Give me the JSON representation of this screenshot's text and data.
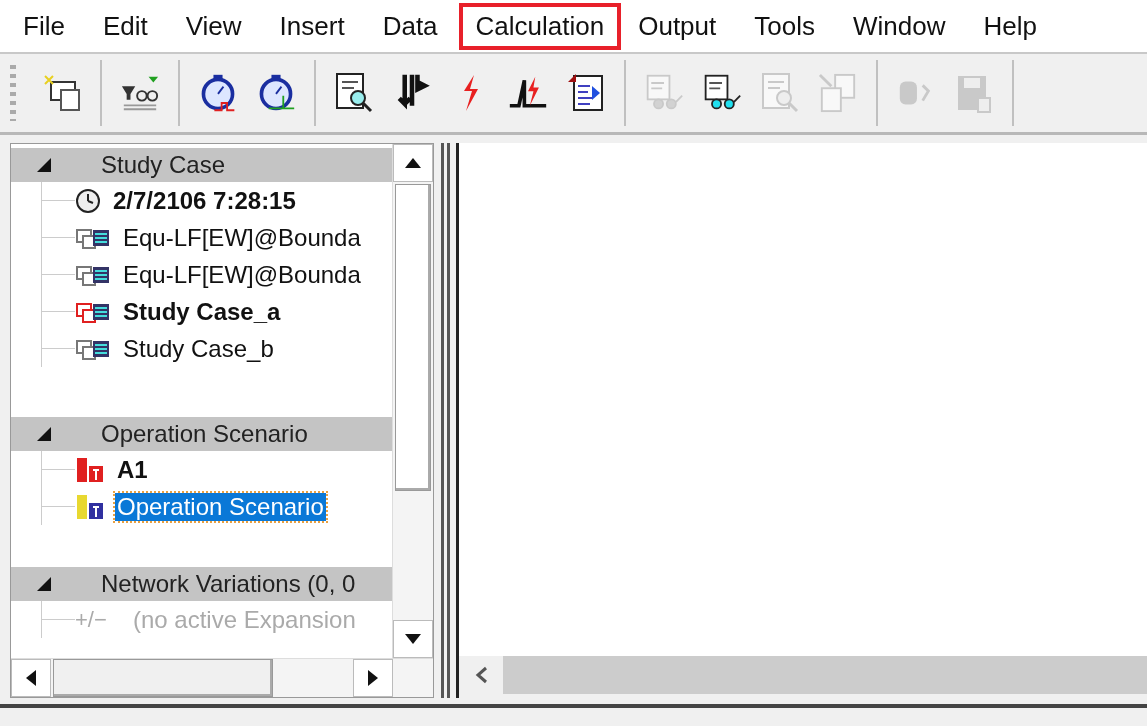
{
  "menu": [
    {
      "label": "File",
      "highlighted": false
    },
    {
      "label": "Edit",
      "highlighted": false
    },
    {
      "label": "View",
      "highlighted": false
    },
    {
      "label": "Insert",
      "highlighted": false
    },
    {
      "label": "Data",
      "highlighted": false
    },
    {
      "label": "Calculation",
      "highlighted": true
    },
    {
      "label": "Output",
      "highlighted": false
    },
    {
      "label": "Tools",
      "highlighted": false
    },
    {
      "label": "Window",
      "highlighted": false
    },
    {
      "label": "Help",
      "highlighted": false
    }
  ],
  "toolbar": [
    [
      {
        "kind": "window",
        "disabled": false
      }
    ],
    [
      {
        "kind": "filter",
        "disabled": false
      }
    ],
    [
      {
        "kind": "stopwatch-pulse",
        "disabled": false
      },
      {
        "kind": "stopwatch-arrow",
        "disabled": false
      }
    ],
    [
      {
        "kind": "doc-search",
        "disabled": false
      },
      {
        "kind": "arrows",
        "disabled": false
      },
      {
        "kind": "lightning",
        "disabled": false
      },
      {
        "kind": "chart-lightning",
        "disabled": false
      },
      {
        "kind": "doc-arrow",
        "disabled": false
      }
    ],
    [
      {
        "kind": "doc-glasses",
        "disabled": true
      },
      {
        "kind": "doc-glasses",
        "disabled": false
      },
      {
        "kind": "doc-search",
        "disabled": true
      },
      {
        "kind": "doc-edit",
        "disabled": true
      }
    ],
    [
      {
        "kind": "chip-undo",
        "disabled": true
      },
      {
        "kind": "save",
        "disabled": true
      }
    ]
  ],
  "tree": {
    "sections": [
      {
        "title": "Study Case",
        "expanded": true,
        "items": [
          {
            "kind": "clock",
            "label": "2/7/2106 7:28:15",
            "active": true,
            "selected": false,
            "disabled": false
          },
          {
            "kind": "case",
            "label": "Equ-LF[EW]@Bounda",
            "active": false,
            "selected": false,
            "disabled": false
          },
          {
            "kind": "case",
            "label": "Equ-LF[EW]@Bounda",
            "active": false,
            "selected": false,
            "disabled": false
          },
          {
            "kind": "case",
            "label": "Study Case_a",
            "active": true,
            "selected": false,
            "disabled": false
          },
          {
            "kind": "case",
            "label": "Study Case_b",
            "active": false,
            "selected": false,
            "disabled": false
          }
        ]
      },
      {
        "title": "Operation Scenario",
        "expanded": true,
        "items": [
          {
            "kind": "scenario",
            "label": "A1",
            "active": true,
            "selected": false,
            "disabled": false
          },
          {
            "kind": "scenario",
            "label": "Operation Scenario",
            "active": false,
            "selected": true,
            "disabled": false
          }
        ]
      },
      {
        "title": "Network Variations (0, 0",
        "expanded": true,
        "items": [
          {
            "kind": "plusminus",
            "symbol": "+/−",
            "label": "(no active Expansion",
            "active": false,
            "selected": false,
            "disabled": true
          }
        ]
      }
    ]
  }
}
